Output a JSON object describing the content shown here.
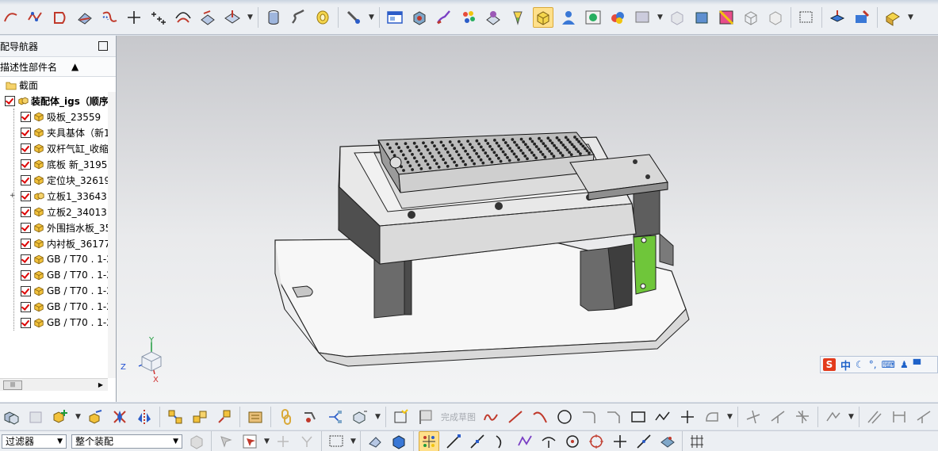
{
  "navigator": {
    "title": "配导航器",
    "column_header": "描述性部件名",
    "items": [
      {
        "label": "截面",
        "kind": "folder"
      },
      {
        "label": "装配体_igs（顺序",
        "kind": "assembly-root"
      },
      {
        "label": "吸板_23559",
        "kind": "part"
      },
      {
        "label": "夹具基体（新1",
        "kind": "part"
      },
      {
        "label": "双杆气缸_收缩",
        "kind": "part"
      },
      {
        "label": "底板 新_31951",
        "kind": "part"
      },
      {
        "label": "定位块_32619",
        "kind": "part"
      },
      {
        "label": "立板1_33643",
        "kind": "subassembly"
      },
      {
        "label": "立板2_34013",
        "kind": "part"
      },
      {
        "label": "外围挡水板_35",
        "kind": "part"
      },
      {
        "label": "内衬板_36177",
        "kind": "part"
      },
      {
        "label": "GB / T70 . 1-2",
        "kind": "part"
      },
      {
        "label": "GB / T70 . 1-2",
        "kind": "part"
      },
      {
        "label": "GB / T70 . 1-2",
        "kind": "part"
      },
      {
        "label": "GB / T70 . 1-2",
        "kind": "part"
      },
      {
        "label": "GB / T70 . 1-2",
        "kind": "part"
      }
    ]
  },
  "viewport": {
    "triad": {
      "y": "Y",
      "z": "Z",
      "x": "X"
    }
  },
  "ime_bar": {
    "logo": "S",
    "mode": "中"
  },
  "bottom_toolbar": {
    "sketch_finish_label": "完成草图"
  },
  "filter_bar": {
    "type_filter": "过滤器",
    "scope_filter": "整个装配"
  },
  "colors": {
    "accent_green": "#6fc63a",
    "check_red": "#d00000",
    "part_yellow": "#f2c23c"
  }
}
